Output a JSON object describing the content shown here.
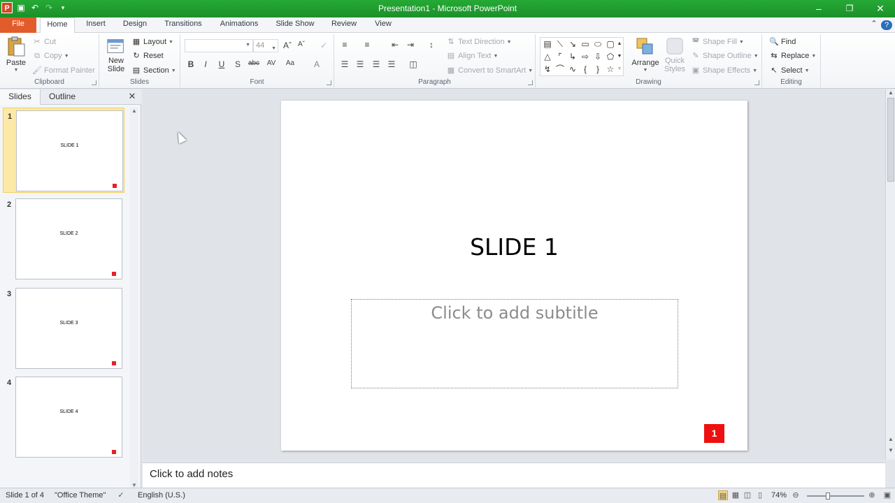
{
  "window": {
    "title": "Presentation1 - Microsoft PowerPoint",
    "app_icon": "P"
  },
  "tabs": {
    "file": "File",
    "items": [
      "Home",
      "Insert",
      "Design",
      "Transitions",
      "Animations",
      "Slide Show",
      "Review",
      "View"
    ],
    "active": "Home"
  },
  "ribbon": {
    "clipboard": {
      "label": "Clipboard",
      "paste": "Paste",
      "cut": "Cut",
      "copy": "Copy",
      "format_painter": "Format Painter"
    },
    "slides": {
      "label": "Slides",
      "new_slide_1": "New",
      "new_slide_2": "Slide",
      "layout": "Layout",
      "reset": "Reset",
      "section": "Section"
    },
    "font": {
      "label": "Font",
      "font_name": "",
      "font_size": "44"
    },
    "paragraph": {
      "label": "Paragraph",
      "text_direction": "Text Direction",
      "align_text": "Align Text",
      "convert_smartart": "Convert to SmartArt"
    },
    "drawing": {
      "label": "Drawing",
      "arrange": "Arrange",
      "quick_styles_1": "Quick",
      "quick_styles_2": "Styles",
      "shape_fill": "Shape Fill",
      "shape_outline": "Shape Outline",
      "shape_effects": "Shape Effects"
    },
    "editing": {
      "label": "Editing",
      "find": "Find",
      "replace": "Replace",
      "select": "Select"
    }
  },
  "left_panel": {
    "tab_slides": "Slides",
    "tab_outline": "Outline",
    "thumbnails": [
      {
        "num": "1",
        "title": "SLIDE 1"
      },
      {
        "num": "2",
        "title": "SLIDE 2"
      },
      {
        "num": "3",
        "title": "SLIDE 3"
      },
      {
        "num": "4",
        "title": "SLIDE 4"
      }
    ],
    "selected_index": 0
  },
  "slide": {
    "title": "SLIDE 1",
    "subtitle_placeholder": "Click to add subtitle",
    "slide_number": "1"
  },
  "notes": {
    "placeholder": "Click to add notes"
  },
  "status": {
    "slide_info": "Slide 1 of 4",
    "theme": "\"Office Theme\"",
    "language": "English (U.S.)",
    "zoom": "74%",
    "zoom_fraction": 0.74
  },
  "colors": {
    "title_bar": "#1b9128",
    "file_tab": "#e25c2b",
    "slide_number_badge": "#ee1010",
    "selected_thumbnail": "#fde9a6"
  }
}
